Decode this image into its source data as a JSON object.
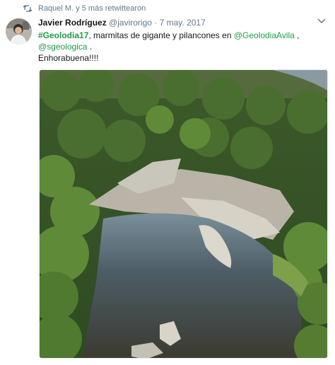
{
  "retweet": {
    "icon": "retweet-icon",
    "text": "Raquel M. y 5 más retwittearon"
  },
  "header": {
    "name": "Javier Rodríguez",
    "handle": "@javirorigo",
    "separator": "·",
    "date": "7 may. 2017",
    "menu_icon": "chevron-down-icon"
  },
  "tweet": {
    "hashtag": "#Geolodia17",
    "text_part1": ", marmitas de gigante y pilancones en ",
    "mention1": "@GeolodiaAvila",
    "text_part2": " ,",
    "mention2": "@sgeologica",
    "text_part3": " .",
    "line3": "Enhorabuena!!!!"
  },
  "colors": {
    "link": "#1d9b47",
    "muted": "#657786",
    "text": "#14171a"
  }
}
